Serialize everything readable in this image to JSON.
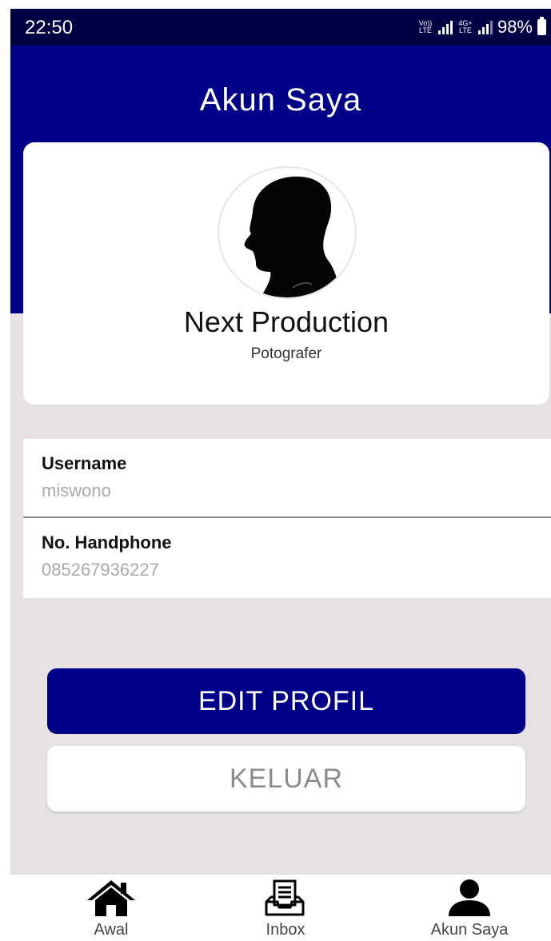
{
  "status_bar": {
    "time": "22:50",
    "net1": "Vo)) LTE",
    "net2": "4G+ LTE",
    "battery": "98%"
  },
  "header": {
    "title": "Akun Saya"
  },
  "profile": {
    "name": "Next Production",
    "role": "Potografer"
  },
  "info": [
    {
      "label": "Username",
      "value": "miswono"
    },
    {
      "label": "No. Handphone",
      "value": "085267936227"
    }
  ],
  "buttons": {
    "edit": "EDIT PROFIL",
    "logout": "KELUAR"
  },
  "bottom_nav": {
    "items": [
      {
        "label": "Awal",
        "icon": "home-icon"
      },
      {
        "label": "Inbox",
        "icon": "inbox-icon"
      },
      {
        "label": "Akun Saya",
        "icon": "user-icon"
      }
    ]
  },
  "colors": {
    "primary": "#000088",
    "status_bar": "#000045",
    "background": "#e7e2e2"
  }
}
